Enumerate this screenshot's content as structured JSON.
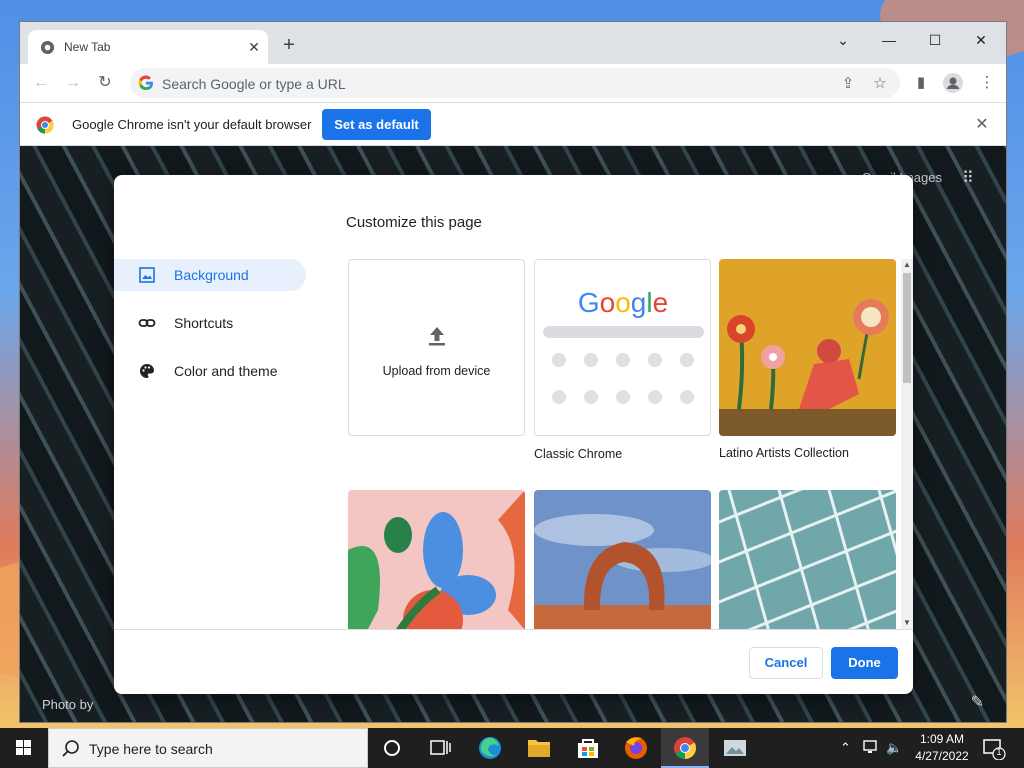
{
  "browser": {
    "tab_title": "New Tab",
    "omnibox_placeholder": "Search Google or type a URL"
  },
  "infobar": {
    "message": "Google Chrome isn't your default browser",
    "button_label": "Set as default"
  },
  "ntp": {
    "top_links": "Gmail  Images",
    "photo_credit": "Photo by"
  },
  "dialog": {
    "title": "Customize this page",
    "menu": [
      {
        "label": "Background",
        "icon": "image-icon",
        "active": true
      },
      {
        "label": "Shortcuts",
        "icon": "link-icon",
        "active": false
      },
      {
        "label": "Color and theme",
        "icon": "palette-icon",
        "active": false
      }
    ],
    "tiles": [
      {
        "label": "Upload from device"
      },
      {
        "label": "Classic Chrome"
      },
      {
        "label": "Latino Artists Collection"
      },
      {
        "label": ""
      },
      {
        "label": ""
      },
      {
        "label": ""
      }
    ],
    "classic_logo": "Google",
    "cancel_label": "Cancel",
    "done_label": "Done"
  },
  "taskbar": {
    "search_placeholder": "Type here to search",
    "time": "1:09 AM",
    "date": "4/27/2022",
    "notification_count": "1"
  },
  "colors": {
    "accent": "#1a73e8",
    "menu_active_bg": "#e8f0fe"
  }
}
